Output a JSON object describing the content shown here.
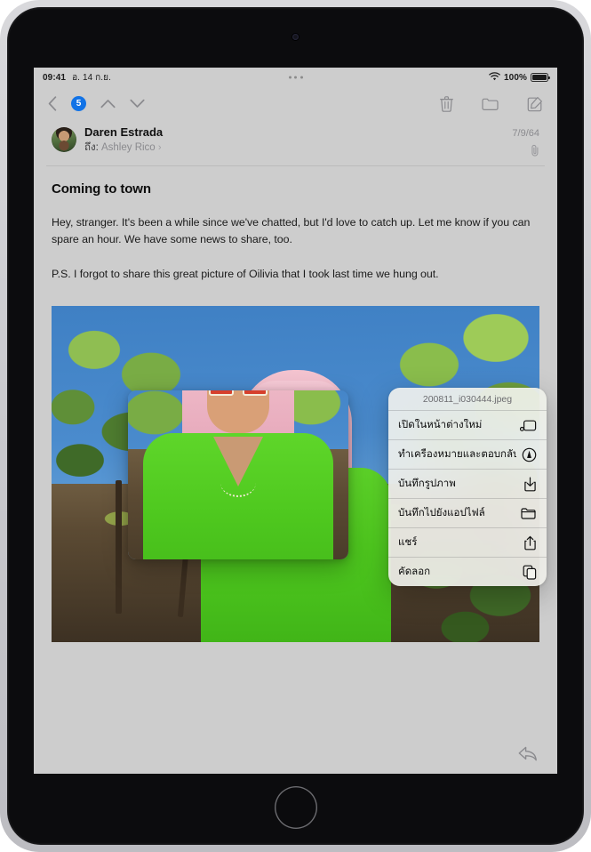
{
  "status_bar": {
    "time": "09:41",
    "date": "อ. 14 ก.ย.",
    "battery_percent": "100%",
    "wifi_icon": "wifi-icon",
    "battery_icon": "battery-full-icon",
    "multitask_dots_icon": "multitasking-dots-icon"
  },
  "toolbar": {
    "back_icon": "chevron-left-icon",
    "unread_count": "5",
    "previous_icon": "chevron-up-icon",
    "next_icon": "chevron-down-icon",
    "trash_icon": "trash-icon",
    "move_icon": "folder-icon",
    "compose_icon": "compose-icon"
  },
  "message": {
    "sender": "Daren Estrada",
    "recipient_label": "ถึง:",
    "recipient": "Ashley Rico",
    "recipient_chevron": "›",
    "date": "7/9/64",
    "attachment_icon": "paperclip-icon",
    "avatar_icon": "contact-avatar",
    "subject": "Coming to town",
    "paragraphs": [
      "Hey, stranger. It's been a while since we've chatted, but I'd love to catch up. Let me know if you can spare an hour. We have some news to share, too.",
      "P.S. I forgot to share this great picture of Oilivia that I took last time we hung out."
    ]
  },
  "attachment": {
    "image_alt": "ผู้หญิงผมสีชมพูสวมแว่นกันแดดและชุดสีเขียวกลางแจ้ง",
    "preview_alt": "ภาพตัวอย่างแบบขยายของรูปภาพที่แนบมา"
  },
  "context_menu": {
    "filename": "200811_i030444.jpeg",
    "items": [
      {
        "label": "เปิดในหน้าต่างใหม่",
        "icon": "new-window-icon"
      },
      {
        "label": "ทำเครื่องหมายและตอบกลับ",
        "icon": "markup-reply-icon"
      },
      {
        "label": "บันทึกรูปภาพ",
        "icon": "save-image-icon"
      },
      {
        "label": "บันทึกไปยังแอปไฟล์",
        "icon": "save-to-files-icon"
      },
      {
        "label": "แชร์",
        "icon": "share-icon"
      },
      {
        "label": "คัดลอก",
        "icon": "copy-icon"
      }
    ]
  },
  "reply_bar": {
    "reply_icon": "reply-arrow-icon"
  },
  "colors": {
    "accent_blue": "#1273e6",
    "screen_bg": "#cdcdcd",
    "menu_bg": "#f3f3ee",
    "text_primary": "#111111",
    "text_secondary": "#8a8a8e"
  }
}
